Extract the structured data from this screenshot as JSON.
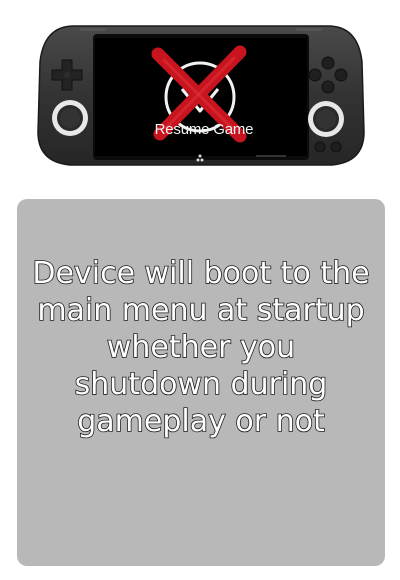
{
  "device": {
    "screen_label": "Resume Game",
    "icons": {
      "dpad": "dpad-icon",
      "face_buttons": "face-buttons-icon",
      "left_stick": "analog-stick-left-icon",
      "right_stick": "analog-stick-right-icon",
      "home_logo": "home-logo-icon",
      "prohibition": "red-cross-icon",
      "resume_logo": "resume-logo-icon"
    },
    "colors": {
      "body": "#3a3a3a",
      "screen": "#000000",
      "cross": "#c8141e"
    }
  },
  "card": {
    "message": "Device will boot to the main menu at startup whether you shutdown during gameplay or not",
    "background": "#b8b8b8"
  }
}
